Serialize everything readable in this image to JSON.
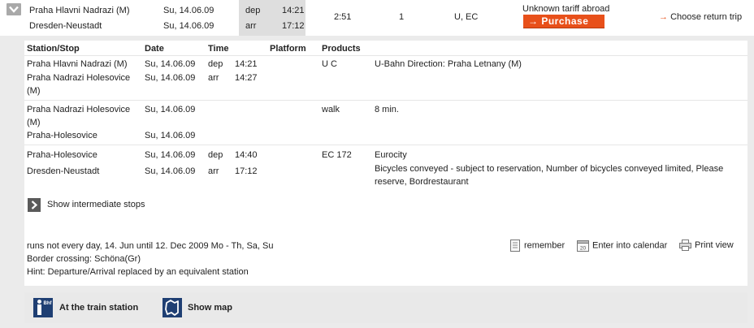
{
  "summary": {
    "from_station": "Praha Hlavni Nadrazi (M)",
    "to_station": "Dresden-Neustadt",
    "dep_date": "Su, 14.06.09",
    "arr_date": "Su, 14.06.09",
    "dep_label": "dep",
    "arr_label": "arr",
    "dep_time": "14:21",
    "arr_time": "17:12",
    "duration": "2:51",
    "changes": "1",
    "products": "U, EC",
    "tariff_text": "Unknown tariff abroad",
    "purchase_label": "Purchase",
    "return_label": "Choose return trip"
  },
  "table": {
    "headers": {
      "station": "Station/Stop",
      "date": "Date",
      "time": "Time",
      "platform": "Platform",
      "products": "Products"
    },
    "legs": [
      {
        "rows": [
          {
            "station": "Praha Hlavni Nadrazi (M)",
            "date": "Su, 14.06.09",
            "kind": "dep",
            "time": "14:21",
            "product": "U C",
            "note": "U-Bahn Direction: Praha Letnany (M)"
          },
          {
            "station": "Praha Nadrazi Holesovice",
            "station2": "(M)",
            "date": "Su, 14.06.09",
            "kind": "arr",
            "time": "14:27"
          }
        ]
      },
      {
        "rows": [
          {
            "station": "Praha Nadrazi Holesovice",
            "station2": "(M)",
            "date": "Su, 14.06.09",
            "product": "walk",
            "note": "8 min."
          },
          {
            "station": "Praha-Holesovice",
            "date": "Su, 14.06.09"
          }
        ]
      },
      {
        "rows": [
          {
            "station": "Praha-Holesovice",
            "date": "Su, 14.06.09",
            "kind": "dep",
            "time": "14:40",
            "product": "EC 172",
            "note": "Eurocity"
          },
          {
            "station": "Dresden-Neustadt",
            "date": "Su, 14.06.09",
            "kind": "arr",
            "time": "17:12",
            "note": "Bicycles conveyed - subject to reservation, Number of bicycles conveyed limited, Please",
            "note2": "reserve, Bordrestaurant"
          }
        ]
      }
    ]
  },
  "intermediate_label": "Show intermediate stops",
  "info": {
    "line1": "runs not every day, 14. Jun until 12. Dec 2009 Mo - Th, Sa, Su",
    "line2": "Border crossing: Schöna(Gr)",
    "line3": "Hint: Departure/Arrival replaced by an equivalent station"
  },
  "tools": {
    "remember": "remember",
    "calendar": "Enter into calendar",
    "calendar_icon_text": "20",
    "print": "Print view"
  },
  "bottom": {
    "station_label": "At the train station",
    "station_icon_text": "Bhf",
    "map_label": "Show map"
  },
  "colors": {
    "accent": "#e8501a",
    "time_column_bg": "#dedede",
    "panel_bg": "#ebebeb"
  }
}
